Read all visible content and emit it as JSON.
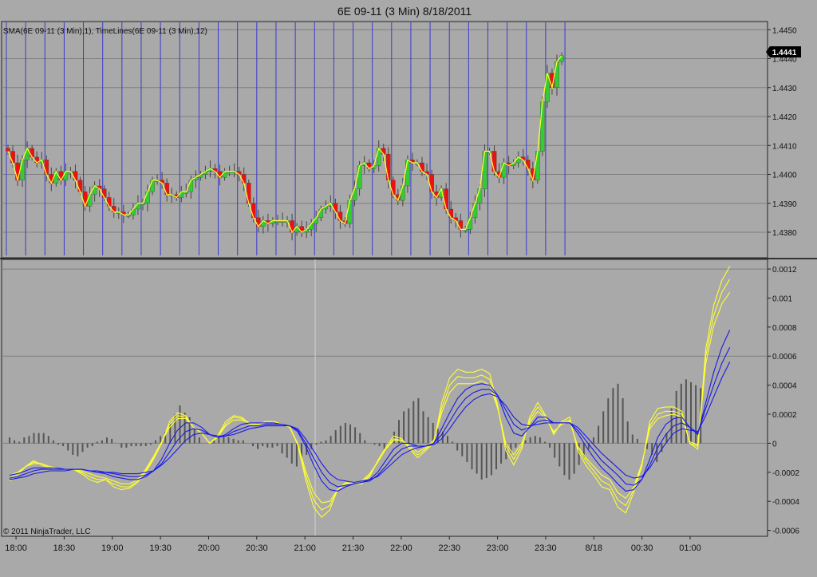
{
  "window": {
    "title": "6E 09-11 (3 Min)  8/18/2011"
  },
  "colors": {
    "background": "#a9a9a9",
    "grid": "#3a3ad0",
    "up_candle": "#33cc33",
    "down_candle": "#ee1111",
    "sma_line": "#ffff33",
    "osc_yellow": "#ffff33",
    "osc_blue": "#1a1ae6",
    "histogram": "#555555",
    "price_marker": "#000000"
  },
  "price_panel": {
    "indicator_label": "SMA(6E 09-11 (3 Min),1), TimeLines(6E 09-11 (3 Min),12)",
    "last_price": "1.4441",
    "y_ticks": [
      "1.4450",
      "1.4440",
      "1.4430",
      "1.4420",
      "1.4410",
      "1.4400",
      "1.4390",
      "1.4380"
    ]
  },
  "osc_panel": {
    "y_ticks": [
      "0.0012",
      "0.001",
      "0.0008",
      "0.0006",
      "0.0004",
      "0.0002",
      "0",
      "-0.0002",
      "-0.0004",
      "-0.0006"
    ],
    "copyright": "© 2011 NinjaTrader, LLC"
  },
  "x_axis": {
    "ticks": [
      "18:00",
      "18:30",
      "19:00",
      "19:30",
      "20:00",
      "20:30",
      "21:00",
      "21:30",
      "22:00",
      "22:30",
      "23:00",
      "23:30",
      "8/18",
      "00:30",
      "01:00"
    ]
  },
  "chart_data": [
    {
      "type": "candlestick",
      "title": "6E 09-11 (3 Min)  8/18/2011",
      "ylim": [
        1.4372,
        1.4452
      ],
      "interval_minutes": 3,
      "first_bar": "17:54",
      "overlay": "SMA(6E 09-11 (3 Min),1)",
      "close": [
        1.4408,
        1.4404,
        1.4398,
        1.4405,
        1.4409,
        1.4406,
        1.4404,
        1.4405,
        1.44,
        1.4397,
        1.4401,
        1.4398,
        1.4401,
        1.4401,
        1.4398,
        1.4394,
        1.4389,
        1.4393,
        1.4396,
        1.4395,
        1.4392,
        1.4389,
        1.4387,
        1.4387,
        1.4386,
        1.4386,
        1.4388,
        1.439,
        1.439,
        1.4394,
        1.4398,
        1.4398,
        1.4397,
        1.4393,
        1.4393,
        1.4392,
        1.4394,
        1.4394,
        1.4398,
        1.4399,
        1.44,
        1.4401,
        1.4402,
        1.4401,
        1.4399,
        1.4401,
        1.4401,
        1.4401,
        1.44,
        1.4397,
        1.439,
        1.4385,
        1.4382,
        1.4384,
        1.4383,
        1.4384,
        1.4384,
        1.4384,
        1.4384,
        1.438,
        1.4382,
        1.438,
        1.4381,
        1.4383,
        1.4385,
        1.4388,
        1.4389,
        1.439,
        1.4387,
        1.4384,
        1.4383,
        1.4391,
        1.4395,
        1.4403,
        1.4404,
        1.4402,
        1.4403,
        1.4409,
        1.4407,
        1.4398,
        1.4393,
        1.4391,
        1.4396,
        1.4405,
        1.4404,
        1.4404,
        1.4401,
        1.44,
        1.4394,
        1.4392,
        1.4395,
        1.4388,
        1.4385,
        1.4384,
        1.4381,
        1.4381,
        1.4385,
        1.439,
        1.4395,
        1.4408,
        1.4408,
        1.4401,
        1.4399,
        1.4404,
        1.4403,
        1.4404,
        1.4406,
        1.4405,
        1.4402,
        1.4398,
        1.4408,
        1.4425,
        1.4435,
        1.443,
        1.4439,
        1.4441
      ]
    },
    {
      "type": "line",
      "title": "",
      "ylim": [
        -0.00063,
        0.00125
      ],
      "series": [
        {
          "values": [
            -0.00026,
            -0.00022,
            -0.00016,
            -0.00012,
            -0.00015,
            -0.00018,
            -0.00017,
            -0.00018,
            -0.00018,
            -0.00021,
            -0.00025,
            -0.00027,
            -0.00025,
            -0.0003,
            -0.00032,
            -0.00031,
            -0.00027,
            -0.0002,
            -0.00011,
            0.0,
            0.00015,
            0.00021,
            0.00019,
            0.00011,
            7e-05,
            0.0,
            5e-05,
            0.00015,
            0.00019,
            0.00018,
            0.00013,
            0.00012,
            0.00015,
            0.00015,
            0.00013,
            0.00012,
            -1e-05,
            -0.00025,
            -0.00044,
            -0.00051,
            -0.00046,
            -0.00032,
            -0.00027,
            -0.00028,
            -0.00028,
            -0.00023,
            -0.00012,
            -3e-05,
            5e-05,
            3e-05,
            -4e-05,
            -0.0001,
            -5e-05,
            0.0,
            0.00028,
            0.00045,
            0.00051,
            0.00049,
            0.00049,
            0.00051,
            0.00048,
            0.00026,
            -5e-05,
            -0.00015,
            -4e-05,
            0.00018,
            0.00028,
            0.00019,
            6e-05,
            0.00015,
            0.00018,
            -5e-05,
            -0.00015,
            -0.00022,
            -0.0003,
            -0.00032,
            -0.00044,
            -0.00048,
            -0.00034,
            -0.00016,
            0.00015,
            0.00024,
            0.00025,
            0.00025,
            0.00022,
            0.0,
            -4e-05,
            0.00065,
            0.00095,
            0.00112,
            0.00122
          ]
        },
        {
          "values": [
            -0.00024,
            -0.00021,
            -0.00016,
            -0.00013,
            -0.00014,
            -0.00017,
            -0.00017,
            -0.00018,
            -0.00018,
            -0.0002,
            -0.00023,
            -0.00025,
            -0.00025,
            -0.00028,
            -0.0003,
            -0.0003,
            -0.00026,
            -0.00019,
            -0.0001,
            1e-05,
            0.00013,
            0.00019,
            0.00018,
            0.00011,
            7e-05,
            0.0,
            5e-05,
            0.00013,
            0.00018,
            0.00017,
            0.00014,
            0.00013,
            0.00015,
            0.00015,
            0.00013,
            0.00011,
            -1e-05,
            -0.00022,
            -0.00039,
            -0.00046,
            -0.00043,
            -0.00032,
            -0.00028,
            -0.00028,
            -0.00027,
            -0.00022,
            -0.00013,
            -4e-05,
            3e-05,
            2e-05,
            -3e-05,
            -8e-05,
            -4e-05,
            1e-05,
            0.00024,
            0.0004,
            0.00046,
            0.00045,
            0.00045,
            0.00047,
            0.00044,
            0.00025,
            -2e-05,
            -0.00011,
            -2e-05,
            0.00016,
            0.00025,
            0.00018,
            7e-05,
            0.00014,
            0.00016,
            -3e-05,
            -0.00012,
            -0.00019,
            -0.00026,
            -0.00029,
            -0.00039,
            -0.00043,
            -0.00032,
            -0.00015,
            0.00012,
            0.0002,
            0.00022,
            0.00022,
            0.0002,
            0.0,
            -2e-05,
            0.0006,
            0.00088,
            0.00104,
            0.00113
          ]
        },
        {
          "values": [
            -0.00022,
            -0.0002,
            -0.00016,
            -0.00014,
            -0.00014,
            -0.00016,
            -0.00017,
            -0.00018,
            -0.00018,
            -0.00019,
            -0.00021,
            -0.00023,
            -0.00024,
            -0.00026,
            -0.00028,
            -0.00028,
            -0.00025,
            -0.00018,
            -9e-05,
            1e-05,
            0.00011,
            0.00017,
            0.00017,
            0.00011,
            7e-05,
            0.0,
            4e-05,
            0.00012,
            0.00016,
            0.00016,
            0.00014,
            0.00013,
            0.00014,
            0.00014,
            0.00013,
            0.00011,
            -0.0,
            -0.00019,
            -0.00034,
            -0.00041,
            -0.0004,
            -0.00032,
            -0.00028,
            -0.00027,
            -0.00026,
            -0.00021,
            -0.00013,
            -4e-05,
            2e-05,
            2e-05,
            -2e-05,
            -6e-05,
            -3e-05,
            2e-05,
            0.00021,
            0.00035,
            0.00041,
            0.00041,
            0.00041,
            0.00043,
            0.0004,
            0.00024,
            0.0,
            -8e-05,
            -0.0,
            0.00014,
            0.00022,
            0.00017,
            8e-05,
            0.00013,
            0.00015,
            -2e-05,
            -0.0001,
            -0.00016,
            -0.00022,
            -0.00025,
            -0.00034,
            -0.00038,
            -0.0003,
            -0.00014,
            0.0001,
            0.00017,
            0.00019,
            0.0002,
            0.00018,
            1e-05,
            -1e-05,
            0.00055,
            0.00081,
            0.00096,
            0.00104
          ]
        },
        {
          "values": [
            -0.00022,
            -0.00021,
            -0.00019,
            -0.00017,
            -0.00017,
            -0.00017,
            -0.00017,
            -0.00018,
            -0.00018,
            -0.00018,
            -0.00019,
            -0.0002,
            -0.00021,
            -0.00023,
            -0.00024,
            -0.00025,
            -0.00025,
            -0.00023,
            -0.00019,
            -0.00011,
            0.0,
            9e-05,
            0.00014,
            0.00014,
            0.00011,
            6e-05,
            4e-05,
            6e-05,
            0.0001,
            0.00013,
            0.00014,
            0.00014,
            0.00014,
            0.00014,
            0.00013,
            0.00012,
            8e-05,
            -2e-05,
            -0.00015,
            -0.00026,
            -0.00032,
            -0.00033,
            -0.0003,
            -0.00028,
            -0.00027,
            -0.00025,
            -0.0002,
            -0.00012,
            -4e-05,
            0.0,
            0.0,
            -2e-05,
            -2e-05,
            0.0,
            0.0001,
            0.00021,
            0.00031,
            0.00037,
            0.0004,
            0.00041,
            0.0004,
            0.00033,
            0.00018,
            7e-05,
            5e-05,
            0.00011,
            0.00018,
            0.00018,
            0.00014,
            0.00014,
            0.00014,
            7e-05,
            -2e-05,
            -0.0001,
            -0.00017,
            -0.00022,
            -0.00028,
            -0.00033,
            -0.00032,
            -0.00025,
            -0.00011,
            4e-05,
            0.00013,
            0.00017,
            0.00018,
            0.00011,
            6e-05,
            0.00028,
            0.00049,
            0.00066,
            0.00078
          ]
        },
        {
          "values": [
            -0.00024,
            -0.00023,
            -0.00021,
            -0.00019,
            -0.00018,
            -0.00018,
            -0.00018,
            -0.00018,
            -0.00018,
            -0.00018,
            -0.00019,
            -0.0002,
            -0.0002,
            -0.00021,
            -0.00022,
            -0.00023,
            -0.00023,
            -0.00022,
            -0.00019,
            -0.00014,
            -6e-05,
            2e-05,
            8e-05,
            0.0001,
            9e-05,
            6e-05,
            4e-05,
            5e-05,
            8e-05,
            0.0001,
            0.00012,
            0.00012,
            0.00013,
            0.00013,
            0.00013,
            0.00012,
            9e-05,
            0.0,
            -0.0001,
            -0.0002,
            -0.00027,
            -0.0003,
            -0.00029,
            -0.00028,
            -0.00027,
            -0.00026,
            -0.00022,
            -0.00016,
            -9e-05,
            -4e-05,
            -2e-05,
            -2e-05,
            -2e-05,
            -0.0,
            6e-05,
            0.00015,
            0.00024,
            0.00031,
            0.00035,
            0.00037,
            0.00037,
            0.00033,
            0.00023,
            0.00013,
            9e-05,
            0.00011,
            0.00015,
            0.00016,
            0.00014,
            0.00014,
            0.00014,
            9e-05,
            2e-05,
            -5e-05,
            -0.00012,
            -0.00017,
            -0.00022,
            -0.00028,
            -0.00029,
            -0.00025,
            -0.00015,
            -3e-05,
            6e-05,
            0.00012,
            0.00014,
            0.00011,
            7e-05,
            0.00024,
            0.0004,
            0.00055,
            0.00066
          ]
        },
        {
          "values": [
            -0.00025,
            -0.00024,
            -0.00023,
            -0.00021,
            -0.0002,
            -0.00019,
            -0.00019,
            -0.00019,
            -0.00018,
            -0.00018,
            -0.00019,
            -0.00019,
            -0.0002,
            -0.0002,
            -0.00021,
            -0.00021,
            -0.00021,
            -0.0002,
            -0.00019,
            -0.00015,
            -0.0001,
            -4e-05,
            2e-05,
            6e-05,
            7e-05,
            6e-05,
            5e-05,
            5e-05,
            6e-05,
            8e-05,
            0.0001,
            0.00011,
            0.00012,
            0.00012,
            0.00012,
            0.00012,
            0.0001,
            3e-05,
            -5e-05,
            -0.00014,
            -0.00021,
            -0.00025,
            -0.00026,
            -0.00027,
            -0.00026,
            -0.00025,
            -0.00023,
            -0.00018,
            -0.00013,
            -8e-05,
            -5e-05,
            -3e-05,
            -2e-05,
            -1e-05,
            3e-05,
            0.0001,
            0.00018,
            0.00025,
            0.0003,
            0.00033,
            0.00034,
            0.00032,
            0.00026,
            0.00018,
            0.00013,
            0.00012,
            0.00013,
            0.00014,
            0.00014,
            0.00014,
            0.00014,
            0.00011,
            5e-05,
            -1e-05,
            -7e-05,
            -0.00012,
            -0.00017,
            -0.00022,
            -0.00024,
            -0.00023,
            -0.00017,
            -8e-05,
            0.0,
            7e-05,
            0.0001,
            9e-05,
            8e-05,
            0.00019,
            0.00032,
            0.00045,
            0.00056
          ]
        },
        {
          "values": [
            4e-05,
            2e-05,
            1e-05,
            4e-05,
            5e-05,
            7e-05,
            7e-05,
            7e-05,
            5e-05,
            2e-05,
            -1e-05,
            -2e-05,
            -5e-05,
            -8e-05,
            -9e-05,
            -6e-05,
            -3e-05,
            -2e-05,
            1e-05,
            2e-05,
            4e-05,
            3e-05,
            -0.0,
            -3e-05,
            -3e-05,
            -2e-05,
            -2e-05,
            -2e-05,
            -2e-05,
            -1e-05,
            2e-05,
            5e-05,
            8e-05,
            0.00014,
            0.0002,
            0.00026,
            0.00021,
            0.00018,
            0.00011,
            4e-05,
            -0.0,
            -0.0,
            2e-05,
            4e-05,
            5e-05,
            4e-05,
            3e-05,
            2e-05,
            2e-05,
            -0.0,
            -2e-05,
            -4e-05,
            -2e-05,
            -3e-05,
            -3e-05,
            -2e-05,
            -7e-05,
            -0.0001,
            -0.00014,
            -0.00016,
            -0.00012,
            -8e-05,
            -4e-05,
            -1e-05,
            1e-05,
            2e-05,
            5e-05,
            9e-05,
            0.00012,
            0.00014,
            0.00013,
            0.00011,
            7e-05,
            2e-05,
            -0.0,
            -1e-05,
            -2e-05,
            -4e-05,
            -1e-05,
            8e-05,
            0.00016,
            0.00022,
            0.00024,
            0.00029,
            0.00031,
            0.00022,
            0.00018,
            0.00014,
            0.0001,
            8e-05,
            5e-05,
            1e-05,
            -5e-05,
            -9e-05,
            -0.00013,
            -0.00018,
            -0.00021,
            -0.00025,
            -0.00024,
            -0.00022,
            -0.00018,
            -0.00014,
            -0.00011,
            -7e-05,
            -3e-05,
            0.0,
            2e-05,
            4e-05,
            5e-05,
            4e-05,
            1e-05,
            -3e-05,
            -0.0001,
            -0.00016,
            -0.00022,
            -0.00025,
            -0.00021,
            -0.00015,
            -0.0001,
            -4e-05,
            4e-05,
            0.00012,
            0.00022,
            0.00031,
            0.00038,
            0.00041,
            0.00031,
            0.00015,
            6e-05,
            3e-05,
            0.0,
            -4e-05,
            -8e-05,
            -0.00013,
            -6e-05,
            7e-05,
            0.00024,
            0.00036,
            0.00041,
            0.00044,
            0.00042,
            0.0004,
            0.00038
          ]
        }
      ]
    }
  ]
}
